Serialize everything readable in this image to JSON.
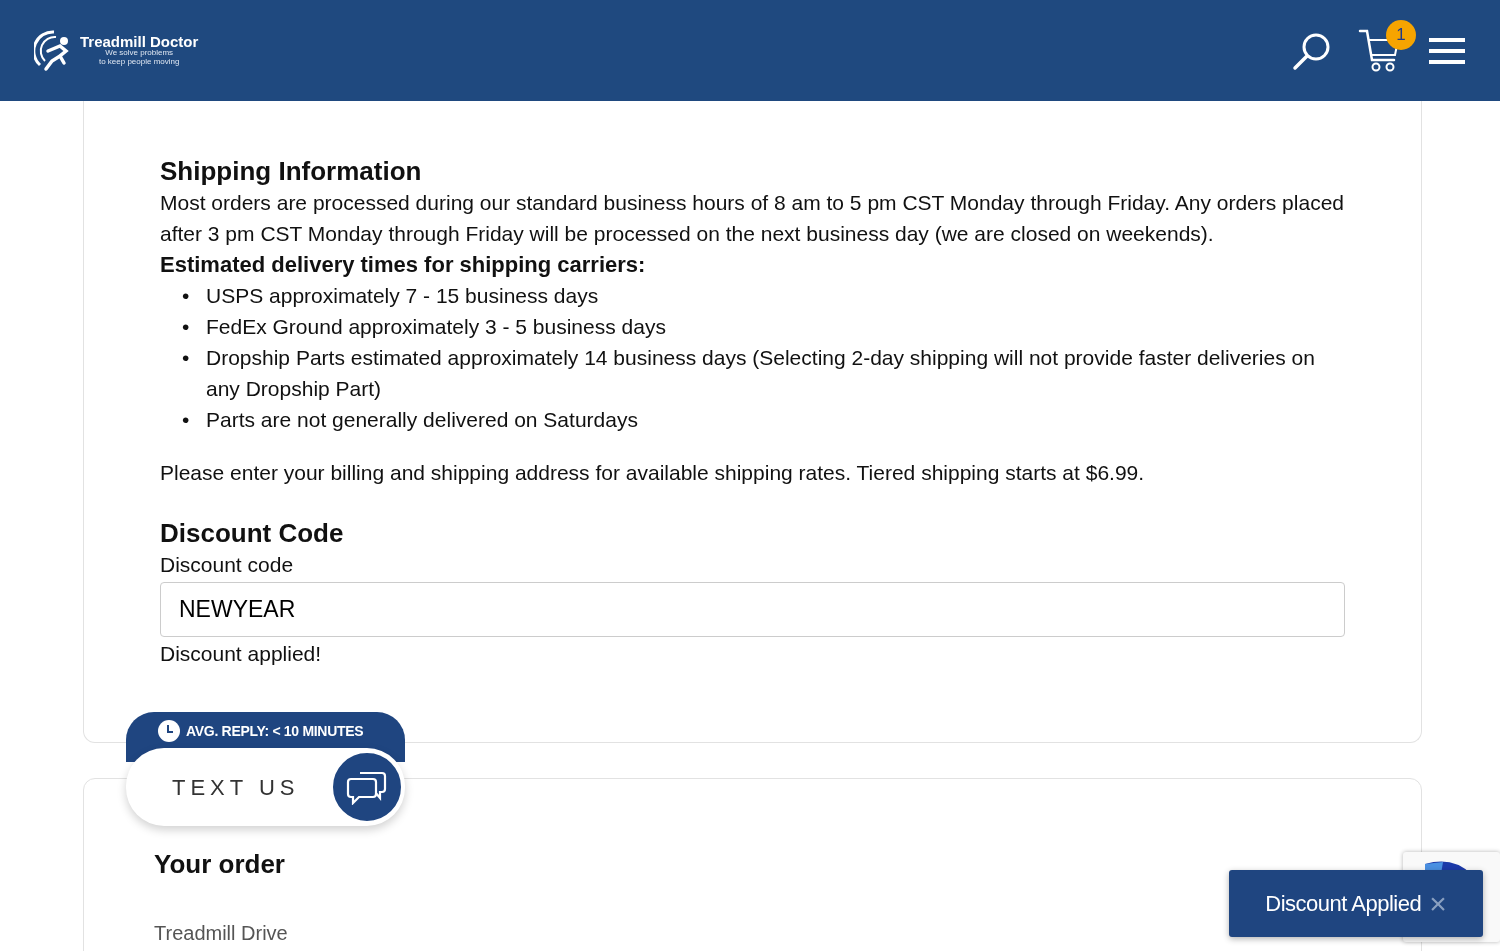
{
  "header": {
    "logo": {
      "name": "Treadmill Doctor",
      "tagline_1": "We solve problems",
      "tagline_2": "to keep people moving"
    },
    "cart_count": "1"
  },
  "shipping": {
    "title": "Shipping Information",
    "intro": "Most orders are processed during our standard business hours of 8 am to 5 pm CST Monday through Friday. Any orders placed after 3 pm CST Monday through Friday will be processed on the next business day (we are closed on weekends).",
    "subtitle": "Estimated delivery times for shipping carriers:",
    "items": [
      {
        "bullet": "•",
        "text": "USPS approximately 7 - 15 business days"
      },
      {
        "bullet": "•",
        "text": "FedEx Ground approximately 3 - 5 business days"
      },
      {
        "bullet": "•",
        "text": "Dropship Parts estimated approximately 14 business days (Selecting 2-day shipping will not provide faster deliveries on any Dropship Part)"
      },
      {
        "bullet": "•",
        "text": "Parts are not generally delivered on Saturdays"
      }
    ],
    "note": "Please enter your billing and shipping address for available shipping rates. Tiered shipping starts at $6.99."
  },
  "discount": {
    "title": "Discount Code",
    "label": "Discount code",
    "value": "NEWYEAR",
    "message": "Discount applied!"
  },
  "chat": {
    "reply_time": "AVG. REPLY: < 10 MINUTES",
    "button": "TEXT US"
  },
  "order": {
    "title": "Your order",
    "item": "Treadmill Drive"
  },
  "toast": {
    "message": "Discount Applied",
    "close": "×"
  }
}
